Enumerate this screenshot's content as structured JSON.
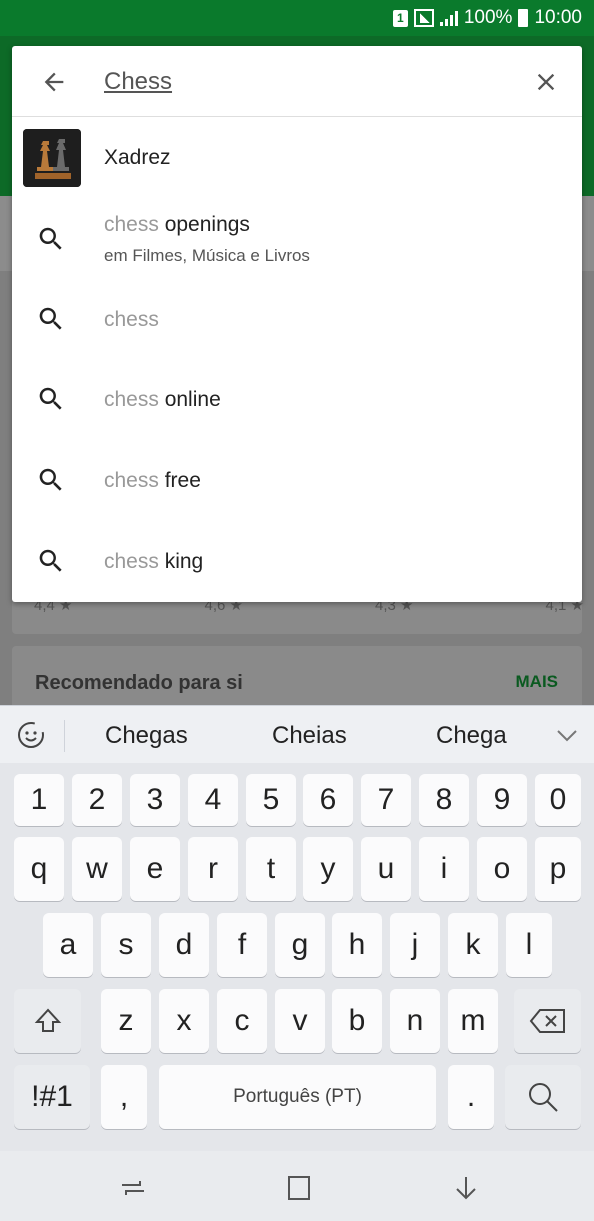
{
  "status_bar": {
    "sim": "1",
    "battery": "100%",
    "time": "10:00"
  },
  "background": {
    "ratings": [
      "4,4 ★",
      "4,6 ★",
      "4,3 ★",
      "4,1 ★"
    ],
    "recommended_title": "Recomendado para si",
    "more_label": "MAIS"
  },
  "search": {
    "query": "Chess"
  },
  "suggestions": [
    {
      "type": "app",
      "title": "Xadrez",
      "icon": "chess-app-icon"
    },
    {
      "type": "query",
      "prefix": "chess",
      "rest": " openings",
      "subtitle": "em Filmes, Música e Livros",
      "icon": "search-icon"
    },
    {
      "type": "query",
      "prefix": "chess",
      "rest": "",
      "icon": "search-icon"
    },
    {
      "type": "query",
      "prefix": "chess",
      "rest": " online",
      "icon": "search-icon"
    },
    {
      "type": "query",
      "prefix": "chess",
      "rest": " free",
      "icon": "search-icon"
    },
    {
      "type": "query",
      "prefix": "chess",
      "rest": " king",
      "icon": "search-icon"
    }
  ],
  "keyboard": {
    "predictions": [
      "Chegas",
      "Cheias",
      "Chega"
    ],
    "row_numbers": [
      "1",
      "2",
      "3",
      "4",
      "5",
      "6",
      "7",
      "8",
      "9",
      "0"
    ],
    "row1": [
      "q",
      "w",
      "e",
      "r",
      "t",
      "y",
      "u",
      "i",
      "o",
      "p"
    ],
    "row2": [
      "a",
      "s",
      "d",
      "f",
      "g",
      "h",
      "j",
      "k",
      "l"
    ],
    "row3": [
      "z",
      "x",
      "c",
      "v",
      "b",
      "n",
      "m"
    ],
    "symbols_key": "!#1",
    "comma_key": ",",
    "space_label": "Português (PT)",
    "period_key": "."
  }
}
